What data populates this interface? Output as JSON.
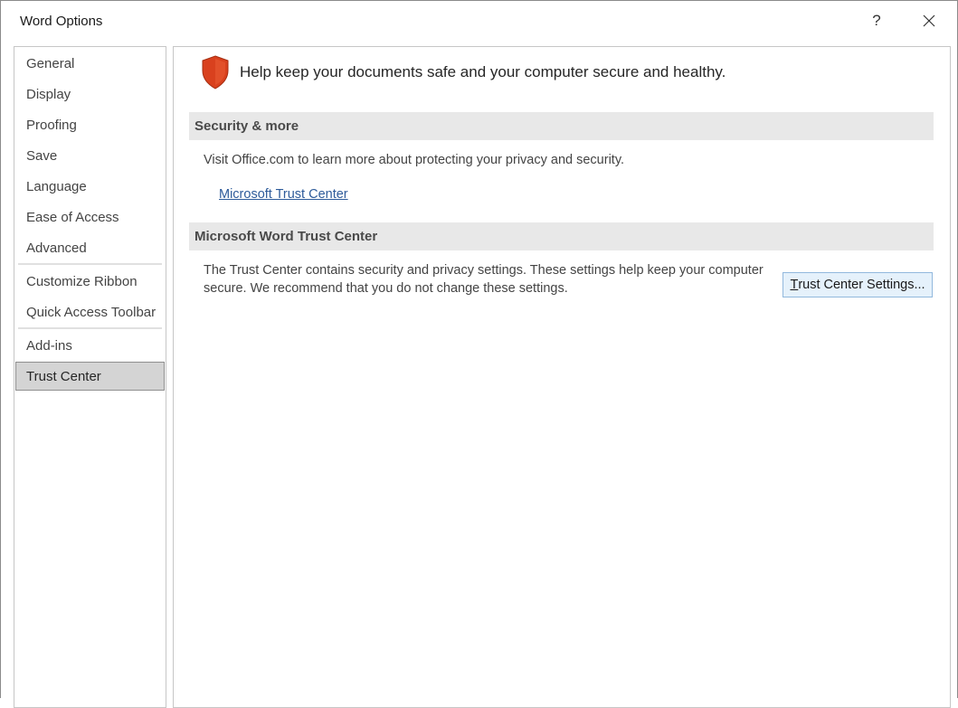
{
  "window": {
    "title": "Word Options",
    "help_label": "?"
  },
  "sidebar": {
    "items": [
      {
        "label": "General"
      },
      {
        "label": "Display"
      },
      {
        "label": "Proofing"
      },
      {
        "label": "Save"
      },
      {
        "label": "Language"
      },
      {
        "label": "Ease of Access"
      },
      {
        "label": "Advanced"
      },
      {
        "label": "Customize Ribbon"
      },
      {
        "label": "Quick Access Toolbar"
      },
      {
        "label": "Add-ins"
      },
      {
        "label": "Trust Center"
      }
    ],
    "selected": "Trust Center"
  },
  "main": {
    "headline": "Help keep your documents safe and your computer secure and healthy.",
    "security_section": {
      "header": "Security & more",
      "text": "Visit Office.com to learn more about protecting your privacy and security.",
      "link": "Microsoft Trust Center"
    },
    "trust_section": {
      "header": "Microsoft Word Trust Center",
      "text_line1": "The Trust Center contains security and privacy settings. These settings help keep your computer",
      "text_line2": "secure. We recommend that you do not change these settings.",
      "button_label": "Trust Center Settings...",
      "button_access_key": "T",
      "button_rest": "rust Center Settings..."
    }
  },
  "colors": {
    "shield": "#d9411e",
    "selected_nav": "#d4d4d4",
    "section_header_bg": "#e8e8e8",
    "link": "#2e5b9a",
    "button_bg": "#e5f1fb"
  },
  "icons": [
    "question-mark-icon",
    "close-icon",
    "shield-icon"
  ]
}
